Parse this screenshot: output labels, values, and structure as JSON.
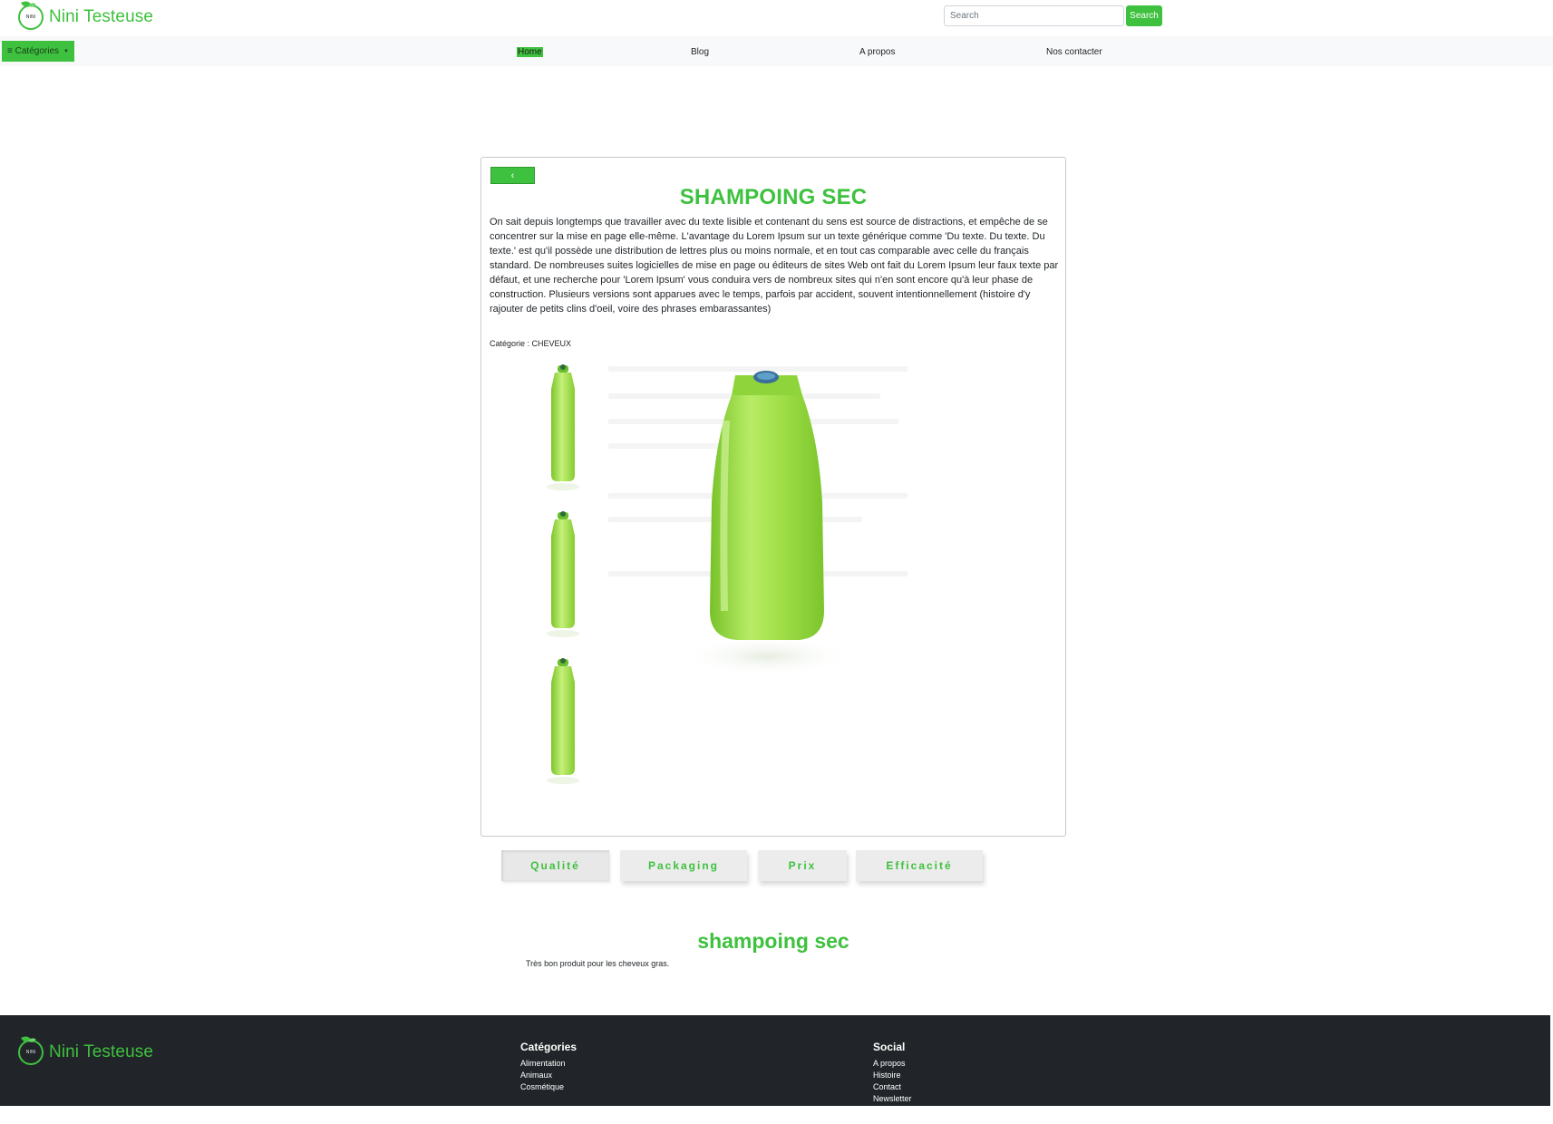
{
  "header": {
    "brand_name": "Nini Testeuse",
    "logo_text": "NINI",
    "search_placeholder": "Search",
    "search_button": "Search"
  },
  "nav": {
    "categories_button": "≡ Catégories",
    "links": [
      "Home",
      "Blog",
      "A propos",
      "Nos contacter"
    ],
    "active_link": "Home"
  },
  "product": {
    "back_label": "‹",
    "title": "SHAMPOING SEC",
    "description": "On sait depuis longtemps que travailler avec du texte lisible et contenant du sens est source de distractions, et empêche de se concentrer sur la mise en page elle-même. L'avantage du Lorem Ipsum sur un texte générique comme 'Du texte. Du texte. Du texte.' est qu'il possède une distribution de lettres plus ou moins normale, et en tout cas comparable avec celle du français standard. De nombreuses suites logicielles de mise en page ou éditeurs de sites Web ont fait du Lorem Ipsum leur faux texte par défaut, et une recherche pour 'Lorem Ipsum' vous conduira vers de nombreux sites qui n'en sont encore qu'à leur phase de construction. Plusieurs versions sont apparues avec le temps, parfois par accident, souvent intentionnellement (histoire d'y rajouter de petits clins d'oeil, voire des phrases embarassantes)",
    "category": "Catégorie : CHEVEUX",
    "image_color": "#8fd43a",
    "thumbnail_count": 3
  },
  "rating_tabs": [
    "Qualité",
    "Packaging",
    "Prix",
    "Efficacité"
  ],
  "review": {
    "title": "shampoing sec",
    "text": "Très bon produit pour les cheveux gras."
  },
  "footer": {
    "brand_name": "Nini Testeuse",
    "categories_title": "Catégories",
    "categories": [
      "Alimentation",
      "Animaux",
      "Cosmétique"
    ],
    "social_title": "Social",
    "social": [
      "A propos",
      "Histoire",
      "Contact",
      "Newsletter"
    ]
  },
  "colors": {
    "accent": "#3ec13e",
    "footer_bg": "#212529",
    "nav_bg": "#f8f9fa"
  }
}
